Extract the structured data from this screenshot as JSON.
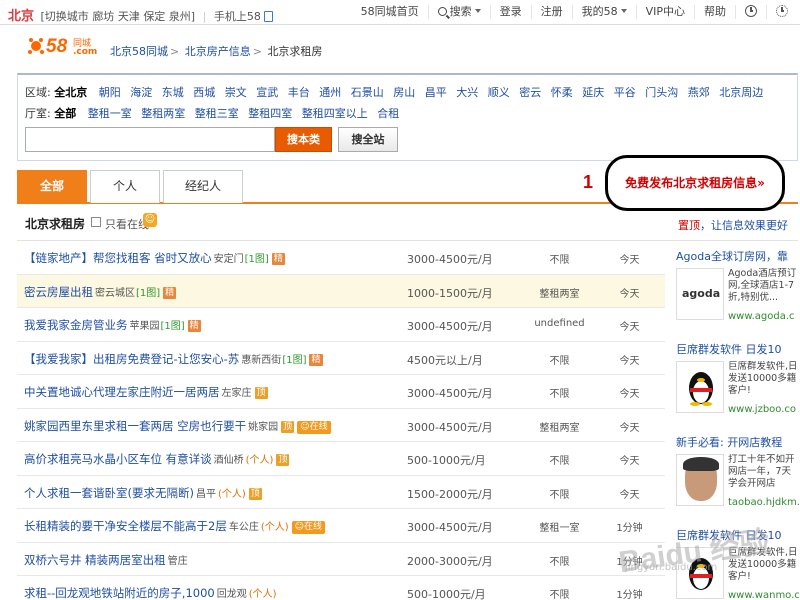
{
  "topbar": {
    "city": "北京",
    "switch_city": "[切换城市",
    "nearby": [
      "廊坊",
      "天津",
      "保定",
      "泉州]"
    ],
    "mobile": "手机上58",
    "home": "58同城首页",
    "search": "搜索",
    "login": "登录",
    "register": "注册",
    "my58": "我的58",
    "vip": "VIP中心",
    "help": "帮助"
  },
  "logo": {
    "num": "58",
    "cn": "同城",
    "dom": ".com"
  },
  "breadcrumb": [
    "北京58同城",
    "北京房产信息",
    "北京求租房"
  ],
  "filter": {
    "district_label": "区域:",
    "district_current": "全北京",
    "districts": [
      "朝阳",
      "海淀",
      "东城",
      "西城",
      "崇文",
      "宣武",
      "丰台",
      "通州",
      "石景山",
      "房山",
      "昌平",
      "大兴",
      "顺义",
      "密云",
      "怀柔",
      "延庆",
      "平谷",
      "门头沟",
      "燕郊",
      "北京周边"
    ],
    "room_label": "厅室:",
    "room_current": "全部",
    "rooms": [
      "整租一室",
      "整租两室",
      "整租三室",
      "整租四室",
      "整租四室以上",
      "合租"
    ],
    "search_category": "搜本类",
    "search_all": "搜全站"
  },
  "tabs": [
    "全部",
    "个人",
    "经纪人"
  ],
  "publish": "免费发布北京求租房信息»",
  "annotation_number": "1",
  "list": {
    "title": "北京求租房",
    "only_online": "只看在线",
    "promo_red": "置顶",
    "promo_text": "，让信息效果更好"
  },
  "rows": [
    {
      "title": "【链家地产】帮您找租客 省时又放心",
      "loc": "安定门",
      "img": "[1图]",
      "individual": "",
      "tag": "精",
      "online": "",
      "price": "3000-4500元/月",
      "room": "不限",
      "date": "今天"
    },
    {
      "title": "密云房屋出租",
      "loc": "密云城区",
      "img": "[1图]",
      "individual": "",
      "tag": "精",
      "online": "",
      "price": "1000-1500元/月",
      "room": "整租两室",
      "date": "今天"
    },
    {
      "title": "我爱我家金房管业务",
      "loc": "苹果园",
      "img": "[1图]",
      "individual": "",
      "tag": "精",
      "online": "",
      "price": "3000-4500元/月",
      "room": "undefined",
      "date": "今天"
    },
    {
      "title": "【我爱我家】出租房免费登记-让您安心-苏",
      "loc": "惠新西街",
      "img": "[1图]",
      "individual": "",
      "tag": "精",
      "online": "",
      "price": "4500元以上/月",
      "room": "不限",
      "date": "今天"
    },
    {
      "title": "中关置地诚心代理左家庄附近一居两居",
      "loc": "左家庄",
      "img": "",
      "individual": "",
      "tag": "顶",
      "online": "",
      "price": "3000-4500元/月",
      "room": "不限",
      "date": "今天"
    },
    {
      "title": "姚家园西里东里求租一套两居 空房也行要干",
      "loc": "姚家园",
      "img": "",
      "individual": "",
      "tag": "顶",
      "online": "在线",
      "price": "3000-4500元/月",
      "room": "整租两室",
      "date": "今天"
    },
    {
      "title": "高价求租亮马水晶小区车位 有意详谈",
      "loc": "酒仙桥",
      "img": "",
      "individual": "(个人)",
      "tag": "顶",
      "online": "",
      "price": "500-1000元/月",
      "room": "不限",
      "date": "今天"
    },
    {
      "title": "个人求租一套谐卧室(要求无隔断)",
      "loc": "昌平",
      "img": "",
      "individual": "(个人)",
      "tag": "顶",
      "online": "",
      "price": "1500-2000元/月",
      "room": "不限",
      "date": "今天"
    },
    {
      "title": "长租精装的要干净安全楼层不能高于2层",
      "loc": "车公庄",
      "img": "",
      "individual": "(个人)",
      "tag": "",
      "online": "在线",
      "price": "3000-4500元/月",
      "room": "整租一室",
      "date": "1分钟"
    },
    {
      "title": "双桥六号井 精装两居室出租",
      "loc": "管庄",
      "img": "",
      "individual": "",
      "tag": "",
      "online": "",
      "price": "2000-3000元/月",
      "room": "不限",
      "date": "1分钟"
    },
    {
      "title": "求租--回龙观地铁站附近的房子,1000",
      "loc": "回龙观",
      "img": "",
      "individual": "(个人)",
      "tag": "",
      "online": "",
      "price": "500-1000元/月",
      "room": "不限",
      "date": "1分钟"
    }
  ],
  "ads": [
    {
      "title": "Agoda全球订房网，靠",
      "desc": "Agoda酒店预订网,全球酒店1-7折,特别优...",
      "url": "www.agoda.c",
      "thumb": "agoda"
    },
    {
      "title": "巨席群发软件 日发10",
      "desc": "巨席群发软件,日发送10000多籍客户!",
      "url": "www.jzboo.co",
      "thumb": ""
    },
    {
      "title": "新手必看: 开网店教程",
      "desc": "打工十年不如开网店一年，7天学会开网店",
      "url": "taobao.hjdkm.",
      "thumb": ""
    },
    {
      "title": "巨席群发软件 日发10",
      "desc": "巨席群发软件,日发送10000多籍客户!",
      "url": "www.wanmo.c",
      "thumb": ""
    }
  ],
  "watermark": "Baidu 经验",
  "watermark_url": "jingyan.baidu.com"
}
